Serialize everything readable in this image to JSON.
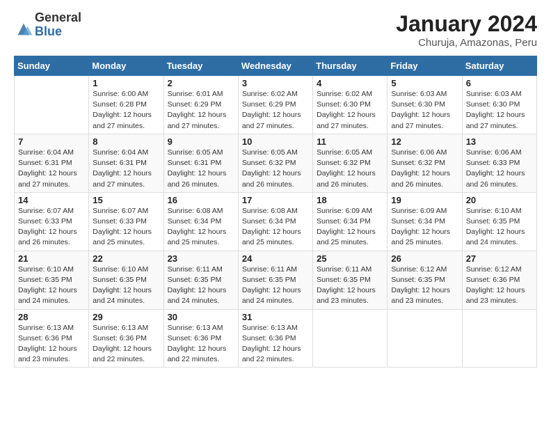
{
  "header": {
    "logo_general": "General",
    "logo_blue": "Blue",
    "title": "January 2024",
    "subtitle": "Churuja, Amazonas, Peru"
  },
  "calendar": {
    "days_of_week": [
      "Sunday",
      "Monday",
      "Tuesday",
      "Wednesday",
      "Thursday",
      "Friday",
      "Saturday"
    ],
    "weeks": [
      [
        {
          "day": "",
          "info": ""
        },
        {
          "day": "1",
          "info": "Sunrise: 6:00 AM\nSunset: 6:28 PM\nDaylight: 12 hours\nand 27 minutes."
        },
        {
          "day": "2",
          "info": "Sunrise: 6:01 AM\nSunset: 6:29 PM\nDaylight: 12 hours\nand 27 minutes."
        },
        {
          "day": "3",
          "info": "Sunrise: 6:02 AM\nSunset: 6:29 PM\nDaylight: 12 hours\nand 27 minutes."
        },
        {
          "day": "4",
          "info": "Sunrise: 6:02 AM\nSunset: 6:30 PM\nDaylight: 12 hours\nand 27 minutes."
        },
        {
          "day": "5",
          "info": "Sunrise: 6:03 AM\nSunset: 6:30 PM\nDaylight: 12 hours\nand 27 minutes."
        },
        {
          "day": "6",
          "info": "Sunrise: 6:03 AM\nSunset: 6:30 PM\nDaylight: 12 hours\nand 27 minutes."
        }
      ],
      [
        {
          "day": "7",
          "info": "Sunrise: 6:04 AM\nSunset: 6:31 PM\nDaylight: 12 hours\nand 27 minutes."
        },
        {
          "day": "8",
          "info": "Sunrise: 6:04 AM\nSunset: 6:31 PM\nDaylight: 12 hours\nand 27 minutes."
        },
        {
          "day": "9",
          "info": "Sunrise: 6:05 AM\nSunset: 6:31 PM\nDaylight: 12 hours\nand 26 minutes."
        },
        {
          "day": "10",
          "info": "Sunrise: 6:05 AM\nSunset: 6:32 PM\nDaylight: 12 hours\nand 26 minutes."
        },
        {
          "day": "11",
          "info": "Sunrise: 6:05 AM\nSunset: 6:32 PM\nDaylight: 12 hours\nand 26 minutes."
        },
        {
          "day": "12",
          "info": "Sunrise: 6:06 AM\nSunset: 6:32 PM\nDaylight: 12 hours\nand 26 minutes."
        },
        {
          "day": "13",
          "info": "Sunrise: 6:06 AM\nSunset: 6:33 PM\nDaylight: 12 hours\nand 26 minutes."
        }
      ],
      [
        {
          "day": "14",
          "info": "Sunrise: 6:07 AM\nSunset: 6:33 PM\nDaylight: 12 hours\nand 26 minutes."
        },
        {
          "day": "15",
          "info": "Sunrise: 6:07 AM\nSunset: 6:33 PM\nDaylight: 12 hours\nand 25 minutes."
        },
        {
          "day": "16",
          "info": "Sunrise: 6:08 AM\nSunset: 6:34 PM\nDaylight: 12 hours\nand 25 minutes."
        },
        {
          "day": "17",
          "info": "Sunrise: 6:08 AM\nSunset: 6:34 PM\nDaylight: 12 hours\nand 25 minutes."
        },
        {
          "day": "18",
          "info": "Sunrise: 6:09 AM\nSunset: 6:34 PM\nDaylight: 12 hours\nand 25 minutes."
        },
        {
          "day": "19",
          "info": "Sunrise: 6:09 AM\nSunset: 6:34 PM\nDaylight: 12 hours\nand 25 minutes."
        },
        {
          "day": "20",
          "info": "Sunrise: 6:10 AM\nSunset: 6:35 PM\nDaylight: 12 hours\nand 24 minutes."
        }
      ],
      [
        {
          "day": "21",
          "info": "Sunrise: 6:10 AM\nSunset: 6:35 PM\nDaylight: 12 hours\nand 24 minutes."
        },
        {
          "day": "22",
          "info": "Sunrise: 6:10 AM\nSunset: 6:35 PM\nDaylight: 12 hours\nand 24 minutes."
        },
        {
          "day": "23",
          "info": "Sunrise: 6:11 AM\nSunset: 6:35 PM\nDaylight: 12 hours\nand 24 minutes."
        },
        {
          "day": "24",
          "info": "Sunrise: 6:11 AM\nSunset: 6:35 PM\nDaylight: 12 hours\nand 24 minutes."
        },
        {
          "day": "25",
          "info": "Sunrise: 6:11 AM\nSunset: 6:35 PM\nDaylight: 12 hours\nand 23 minutes."
        },
        {
          "day": "26",
          "info": "Sunrise: 6:12 AM\nSunset: 6:35 PM\nDaylight: 12 hours\nand 23 minutes."
        },
        {
          "day": "27",
          "info": "Sunrise: 6:12 AM\nSunset: 6:36 PM\nDaylight: 12 hours\nand 23 minutes."
        }
      ],
      [
        {
          "day": "28",
          "info": "Sunrise: 6:13 AM\nSunset: 6:36 PM\nDaylight: 12 hours\nand 23 minutes."
        },
        {
          "day": "29",
          "info": "Sunrise: 6:13 AM\nSunset: 6:36 PM\nDaylight: 12 hours\nand 22 minutes."
        },
        {
          "day": "30",
          "info": "Sunrise: 6:13 AM\nSunset: 6:36 PM\nDaylight: 12 hours\nand 22 minutes."
        },
        {
          "day": "31",
          "info": "Sunrise: 6:13 AM\nSunset: 6:36 PM\nDaylight: 12 hours\nand 22 minutes."
        },
        {
          "day": "",
          "info": ""
        },
        {
          "day": "",
          "info": ""
        },
        {
          "day": "",
          "info": ""
        }
      ]
    ]
  }
}
